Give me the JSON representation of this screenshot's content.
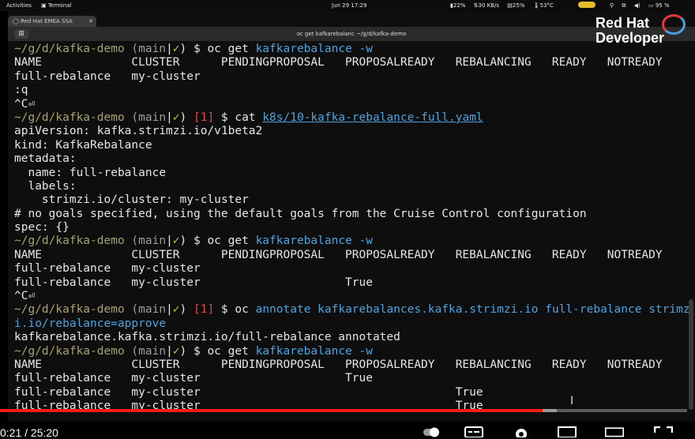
{
  "topbar": {
    "activities": "Activities",
    "app_name": "Terminal",
    "clock": "Jun 29  17:29",
    "indicators": [
      "22%",
      "30 KB/s",
      "25%",
      "53°C"
    ],
    "battery": "95 %"
  },
  "browser_tab": {
    "label": "Red Hat EMEA SSA"
  },
  "window": {
    "title": "oc get kafkarebalanc ~/g/d/kafka-demo"
  },
  "brand": {
    "line1": "Red Hat",
    "line2": "Developer"
  },
  "terminal": {
    "lines": [
      [
        {
          "t": "~/g/d/kafka-demo ",
          "c": "prompt"
        },
        {
          "t": "(",
          "c": "branch"
        },
        {
          "t": "main",
          "c": "branch"
        },
        {
          "t": "|",
          "c": "plain"
        },
        {
          "t": "✓",
          "c": "check"
        },
        {
          "t": ") $ ",
          "c": "plain"
        },
        {
          "t": "oc get ",
          "c": "plain"
        },
        {
          "t": "kafkarebalance -w",
          "c": "cmd"
        }
      ],
      [
        {
          "t": "NAME             CLUSTER      PENDINGPROPOSAL   PROPOSALREADY   REBALANCING   READY   NOTREADY",
          "c": "plain"
        }
      ],
      [
        {
          "t": "full-rebalance   my-cluster",
          "c": "plain"
        }
      ],
      [
        {
          "t": ":q",
          "c": "plain"
        }
      ],
      [
        {
          "t": "^C⏎",
          "c": "plain"
        }
      ],
      [
        {
          "t": "~/g/d/kafka-demo ",
          "c": "prompt"
        },
        {
          "t": "(",
          "c": "branch"
        },
        {
          "t": "main",
          "c": "branch"
        },
        {
          "t": "|",
          "c": "plain"
        },
        {
          "t": "✓",
          "c": "check"
        },
        {
          "t": ") ",
          "c": "plain"
        },
        {
          "t": "[1]",
          "c": "err"
        },
        {
          "t": " $ cat ",
          "c": "plain"
        },
        {
          "t": "k8s/10-kafka-rebalance-full.yaml",
          "c": "link"
        }
      ],
      [
        {
          "t": "apiVersion: kafka.strimzi.io/v1beta2",
          "c": "plain"
        }
      ],
      [
        {
          "t": "kind: KafkaRebalance",
          "c": "plain"
        }
      ],
      [
        {
          "t": "metadata:",
          "c": "plain"
        }
      ],
      [
        {
          "t": "  name: full-rebalance",
          "c": "plain"
        }
      ],
      [
        {
          "t": "  labels:",
          "c": "plain"
        }
      ],
      [
        {
          "t": "    strimzi.io/cluster: my-cluster",
          "c": "plain"
        }
      ],
      [
        {
          "t": "# no goals specified, using the default goals from the Cruise Control configuration",
          "c": "plain"
        }
      ],
      [
        {
          "t": "spec: {}",
          "c": "plain"
        }
      ],
      [
        {
          "t": "~/g/d/kafka-demo ",
          "c": "prompt"
        },
        {
          "t": "(",
          "c": "branch"
        },
        {
          "t": "main",
          "c": "branch"
        },
        {
          "t": "|",
          "c": "plain"
        },
        {
          "t": "✓",
          "c": "check"
        },
        {
          "t": ") $ ",
          "c": "plain"
        },
        {
          "t": "oc get ",
          "c": "plain"
        },
        {
          "t": "kafkarebalance -w",
          "c": "cmd"
        }
      ],
      [
        {
          "t": "NAME             CLUSTER      PENDINGPROPOSAL   PROPOSALREADY   REBALANCING   READY   NOTREADY",
          "c": "plain"
        }
      ],
      [
        {
          "t": "full-rebalance   my-cluster",
          "c": "plain"
        }
      ],
      [
        {
          "t": "full-rebalance   my-cluster                     True",
          "c": "plain"
        }
      ],
      [
        {
          "t": "^C⏎",
          "c": "plain"
        }
      ],
      [
        {
          "t": "~/g/d/kafka-demo ",
          "c": "prompt"
        },
        {
          "t": "(",
          "c": "branch"
        },
        {
          "t": "main",
          "c": "branch"
        },
        {
          "t": "|",
          "c": "plain"
        },
        {
          "t": "✓",
          "c": "check"
        },
        {
          "t": ") ",
          "c": "plain"
        },
        {
          "t": "[1]",
          "c": "err"
        },
        {
          "t": " $ oc ",
          "c": "plain"
        },
        {
          "t": "annotate kafkarebalances.kafka.strimzi.io full-rebalance strimz",
          "c": "cmd"
        }
      ],
      [
        {
          "t": "i.io/rebalance=approve",
          "c": "cmd"
        }
      ],
      [
        {
          "t": "kafkarebalance.kafka.strimzi.io/full-rebalance annotated",
          "c": "plain"
        }
      ],
      [
        {
          "t": "~/g/d/kafka-demo ",
          "c": "prompt"
        },
        {
          "t": "(",
          "c": "branch"
        },
        {
          "t": "main",
          "c": "branch"
        },
        {
          "t": "|",
          "c": "plain"
        },
        {
          "t": "✓",
          "c": "check"
        },
        {
          "t": ") $ ",
          "c": "plain"
        },
        {
          "t": "oc get ",
          "c": "plain"
        },
        {
          "t": "kafkarebalance -w",
          "c": "cmd"
        }
      ],
      [
        {
          "t": "NAME             CLUSTER      PENDINGPROPOSAL   PROPOSALREADY   REBALANCING   READY   NOTREADY",
          "c": "plain"
        }
      ],
      [
        {
          "t": "full-rebalance   my-cluster                     True",
          "c": "plain"
        }
      ],
      [
        {
          "t": "full-rebalance   my-cluster                                     True",
          "c": "plain"
        }
      ],
      [
        {
          "t": "full-rebalance   my-cluster                                     True",
          "c": "plain"
        }
      ]
    ]
  },
  "player": {
    "timecode": "0:21 / 25:20",
    "progress_fraction": 0.79,
    "buffered_fraction": 0.81
  },
  "colors": {
    "prompt": "#a8a36b",
    "check": "#d7c44a",
    "err": "#e24c4c",
    "cmd": "#4da3e0",
    "progress": "#ff1a1a"
  }
}
